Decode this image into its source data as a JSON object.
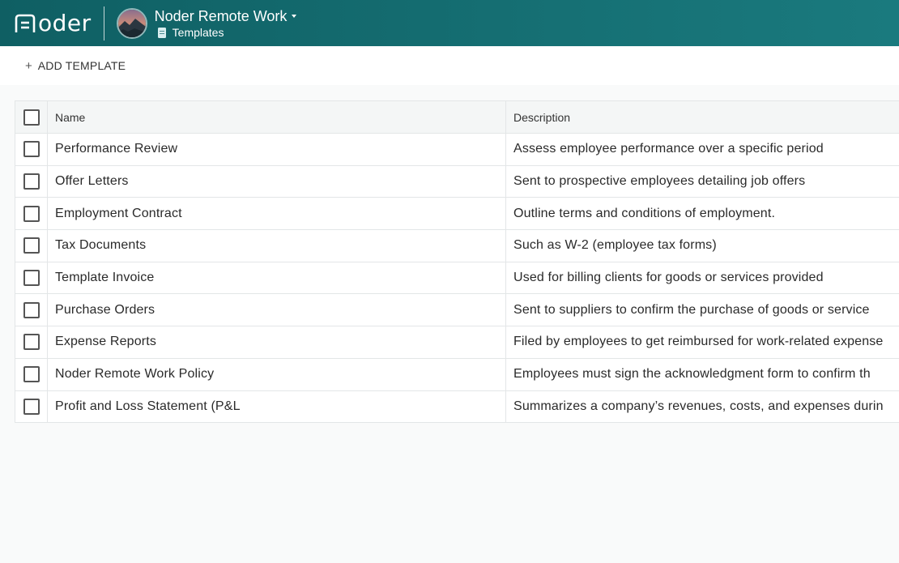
{
  "app": {
    "logo_text": "oder",
    "workspace_name": "Noder Remote Work",
    "section_label": "Templates"
  },
  "toolbar": {
    "add_label": "ADD TEMPLATE",
    "add_icon": "plus-icon"
  },
  "table": {
    "columns": [
      "Name",
      "Description"
    ],
    "rows": [
      {
        "name": "Performance Review",
        "description": "Assess employee performance over a specific period"
      },
      {
        "name": "Offer Letters",
        "description": "Sent to prospective employees detailing job offers"
      },
      {
        "name": "Employment Contract",
        "description": "Outline terms and conditions of employment."
      },
      {
        "name": "Tax Documents",
        "description": "Such as W-2 (employee tax forms)"
      },
      {
        "name": "Template Invoice",
        "description": "Used for billing clients for goods or services provided"
      },
      {
        "name": "Purchase Orders",
        "description": "Sent to suppliers to confirm the purchase of goods or service"
      },
      {
        "name": "Expense Reports",
        "description": "Filed by employees to get reimbursed for work-related expense"
      },
      {
        "name": "Noder Remote Work Policy",
        "description": "Employees must sign the acknowledgment form to confirm th"
      },
      {
        "name": "Profit and Loss Statement (P&L",
        "description": "Summarizes a company’s revenues, costs, and expenses durin"
      }
    ]
  },
  "colors": {
    "header_bg": "#156e72",
    "accent_text": "#ffffff"
  }
}
